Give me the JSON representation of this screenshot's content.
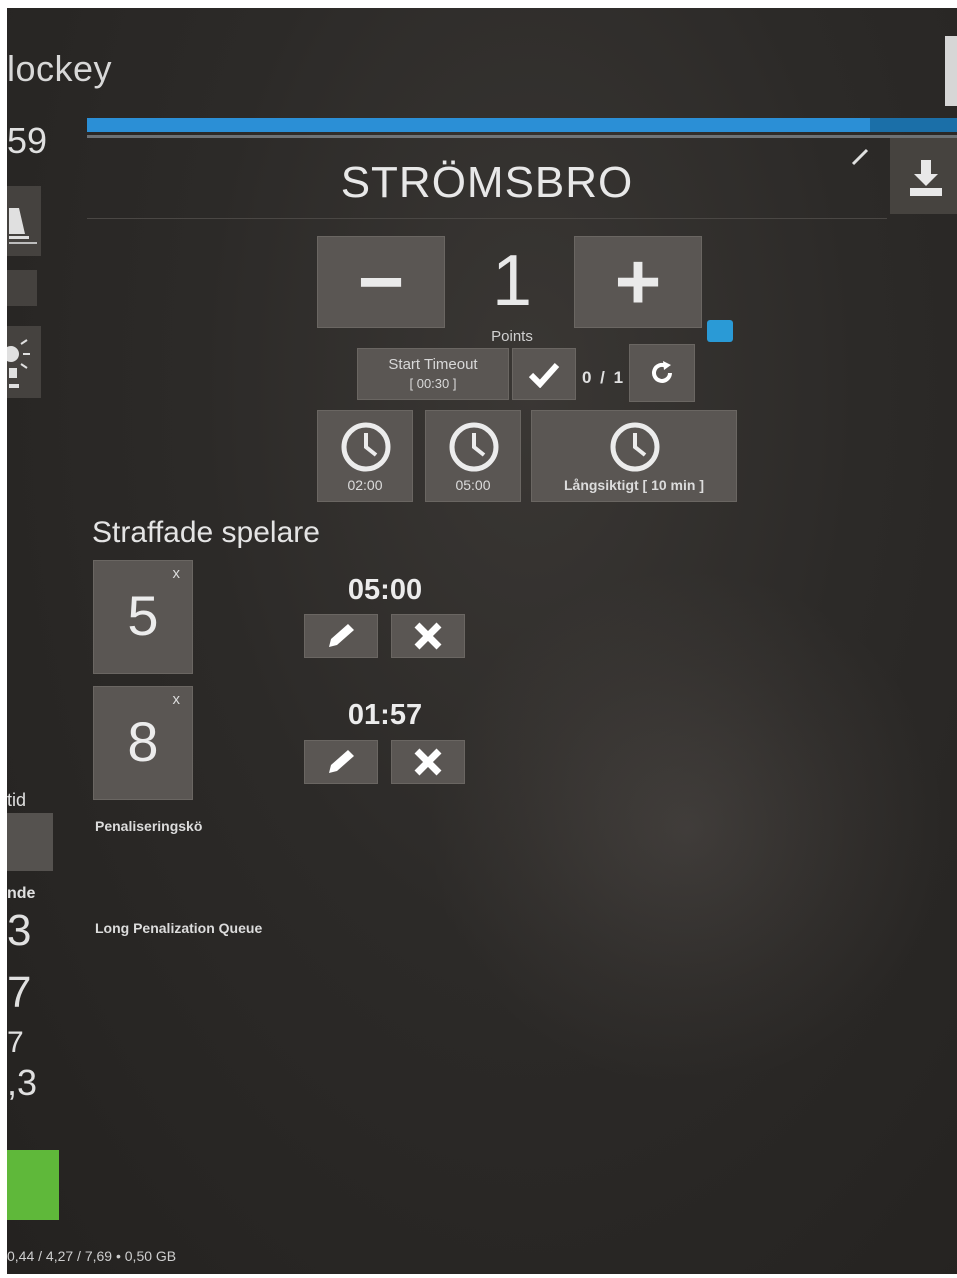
{
  "app": {
    "title": "Hockey",
    "title_visible": "lockey"
  },
  "left_panel": {
    "top_number": "59",
    "label_tid": "tid",
    "label_nde": "nde",
    "stats": [
      "3",
      "7",
      "7",
      ",3"
    ],
    "status_color": "#5fb83a"
  },
  "progress": {
    "value_percent": 90,
    "accent": "#2b8fd6"
  },
  "team": {
    "name": "STRÖMSBRO"
  },
  "score": {
    "minus_label": "−",
    "value": "1",
    "plus_label": "+",
    "points_label": "Points"
  },
  "timeout": {
    "start_label": "Start Timeout",
    "duration": "[ 00:30 ]",
    "counter": "0 / 1"
  },
  "penalty_buttons": [
    {
      "label": "02:00",
      "icon": "clock-icon"
    },
    {
      "label": "05:00",
      "icon": "clock-icon"
    },
    {
      "label": "Långsiktigt  [ 10 min ]",
      "icon": "clock-icon"
    }
  ],
  "penalized": {
    "title": "Straffade spelare",
    "players": [
      {
        "number": "5",
        "remove": "x",
        "time": "05:00"
      },
      {
        "number": "8",
        "remove": "x",
        "time": "01:57"
      }
    ],
    "queue_label": "Penaliseringskö",
    "long_queue_label": "Long Penalization Queue"
  },
  "footer": {
    "memory": "0,44 / 4,27 / 7,69 • 0,50 GB"
  },
  "icons": {
    "edit": "pencil-icon",
    "download": "download-icon",
    "confirm": "check-icon",
    "reset": "refresh-icon",
    "delete": "close-icon"
  }
}
